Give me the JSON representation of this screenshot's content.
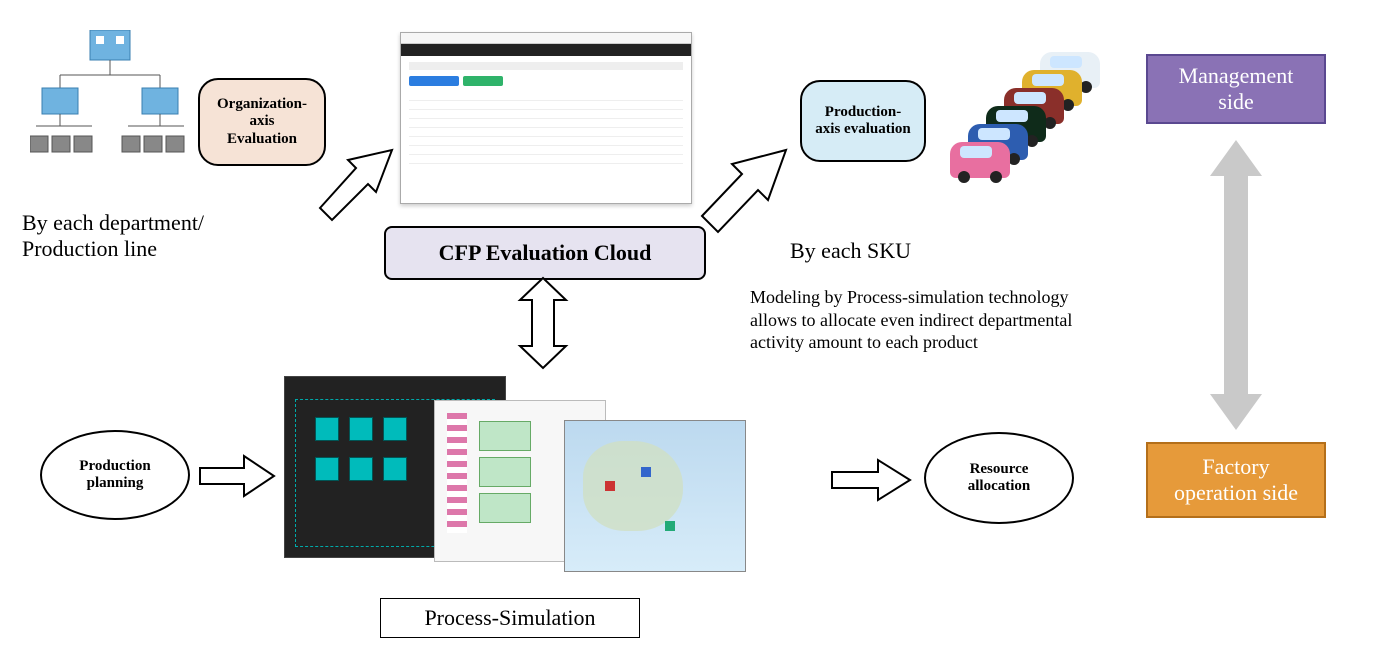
{
  "nodes": {
    "org_axis": "Organization-\naxis\nEvaluation",
    "prod_axis": "Production-\naxis evaluation",
    "center": "CFP Evaluation Cloud",
    "production_planning": "Production\nplanning",
    "resource_allocation": "Resource\nallocation",
    "process_sim": "Process-Simulation"
  },
  "captions": {
    "by_department": "By each department/\nProduction line",
    "by_sku": "By each SKU",
    "modeling_note": "Modeling by Process-simulation technology allows to allocate even indirect departmental activity amount to each product"
  },
  "side": {
    "management": "Management\nside",
    "factory": "Factory\noperation side"
  },
  "icons": {
    "org_tree": "org-hierarchy-icon",
    "cars": "car-line-icon",
    "browser": "cloud-app-screenshot",
    "sim": "simulation-screenshot",
    "map": "map-screenshot"
  }
}
